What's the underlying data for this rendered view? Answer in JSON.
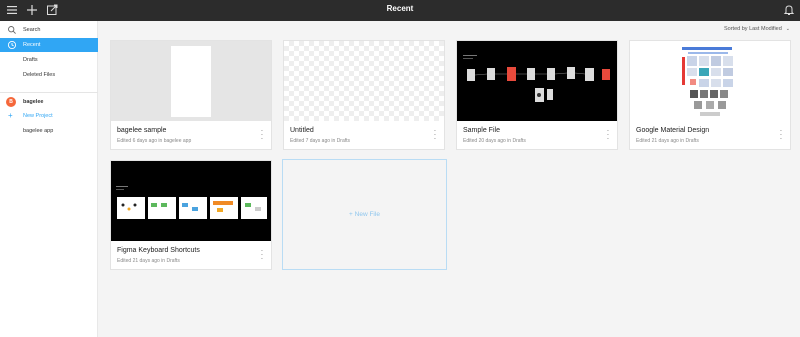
{
  "topbar": {
    "title": "Recent"
  },
  "sidebar": {
    "search": "Search",
    "recent": "Recent",
    "drafts": "Drafts",
    "deleted": "Deleted Files",
    "team_initial": "B",
    "team_name": "bagelee",
    "new_project": "New Project",
    "project": "bagelee app"
  },
  "sort": {
    "label": "Sorted by Last Modified"
  },
  "files": [
    {
      "name": "bagelee sample",
      "meta": "Edited 6 days ago in bagelee app"
    },
    {
      "name": "Untitled",
      "meta": "Edited 7 days ago in Drafts"
    },
    {
      "name": "Sample File",
      "meta": "Edited 20 days ago in Drafts"
    },
    {
      "name": "Google Material Design",
      "meta": "Edited 21 days ago in Drafts"
    },
    {
      "name": "Figma Keyboard Shortcuts",
      "meta": "Edited 21 days ago in Drafts"
    }
  ],
  "new_file": {
    "label": "New File"
  },
  "colors": {
    "accent": "#30a6f4",
    "topbar": "#2c2c2c",
    "avatar": "#f5673a"
  }
}
